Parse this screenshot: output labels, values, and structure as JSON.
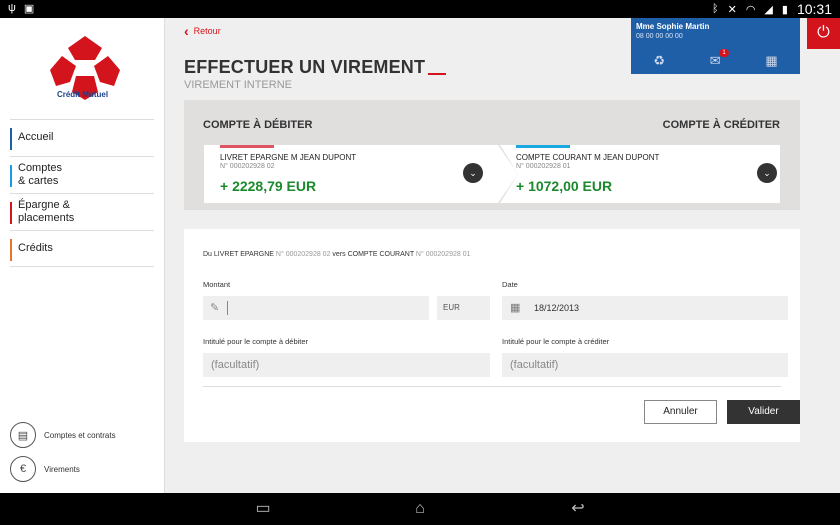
{
  "status_bar": {
    "time": "10:31"
  },
  "brand": {
    "name": "Crédit Mutuel"
  },
  "sidebar": {
    "items": [
      {
        "label": "Accueil",
        "color": "#1f5fa8"
      },
      {
        "label": "Comptes\n& cartes",
        "color": "#1a9be0"
      },
      {
        "label": "Épargne &\nplacements",
        "color": "#d4141c"
      },
      {
        "label": "Crédits",
        "color": "#e8732a"
      }
    ],
    "bottom_links": [
      {
        "label": "Comptes et contrats",
        "icon": "document-icon"
      },
      {
        "label": "Virements",
        "icon": "euro-transfer-icon"
      }
    ]
  },
  "header": {
    "back_label": "Retour",
    "title": "EFFECTUER UN VIREMENT",
    "subtitle": "VIREMENT INTERNE"
  },
  "user": {
    "name": "Mme Sophie Martin",
    "phone": "08 00 00 00 00",
    "messages_badge": "1"
  },
  "accounts": {
    "debit_header": "COMPTE À DÉBITER",
    "credit_header": "COMPTE À CRÉDITER",
    "debit": {
      "name": "LIVRET EPARGNE M JEAN DUPONT",
      "number": "N° 000202928 02",
      "balance": "+ 2228,79 EUR",
      "color": "#e05563"
    },
    "credit": {
      "name": "COMPTE COURANT M JEAN DUPONT",
      "number": "N° 000202928 01",
      "balance": "+ 1072,00 EUR",
      "color": "#1aa8e0"
    }
  },
  "form": {
    "desc_from": "Du LIVRET EPARGNE",
    "desc_from_num": "N° 000202928 02",
    "desc_to": "vers COMPTE COURANT",
    "desc_to_num": "N° 000202928 01",
    "amount_label": "Montant",
    "currency": "EUR",
    "date_label": "Date",
    "date_value": "18/12/2013",
    "debit_label": "Intitulé pour le compte à débiter",
    "credit_label": "Intitulé pour le compte à créditer",
    "placeholder": "(facultatif)",
    "cancel_label": "Annuler",
    "submit_label": "Valider"
  }
}
